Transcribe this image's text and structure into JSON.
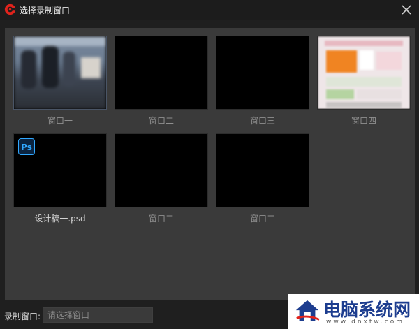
{
  "window": {
    "title": "选择录制窗口",
    "close_icon": "close-icon",
    "app_icon": "app-logo-icon"
  },
  "thumbnails": [
    {
      "label": "窗口一",
      "preview": "photo"
    },
    {
      "label": "窗口二",
      "preview": "black"
    },
    {
      "label": "窗口三",
      "preview": "black"
    },
    {
      "label": "窗口四",
      "preview": "webpage"
    },
    {
      "label": "设计稿一.psd",
      "preview": "photoshop",
      "badge": "Ps"
    },
    {
      "label": "窗口二",
      "preview": "black"
    },
    {
      "label": "窗口二",
      "preview": "black"
    }
  ],
  "footer": {
    "label": "录制窗口:",
    "input_value": "",
    "input_placeholder": "请选择窗口"
  },
  "watermark": {
    "text": "电脑系统网",
    "url": "www.dnxtw.com"
  },
  "colors": {
    "background": "#1f1f1f",
    "panel": "#3a3a3a",
    "accent_red": "#e0231c",
    "ps_blue": "#31a8ff"
  }
}
